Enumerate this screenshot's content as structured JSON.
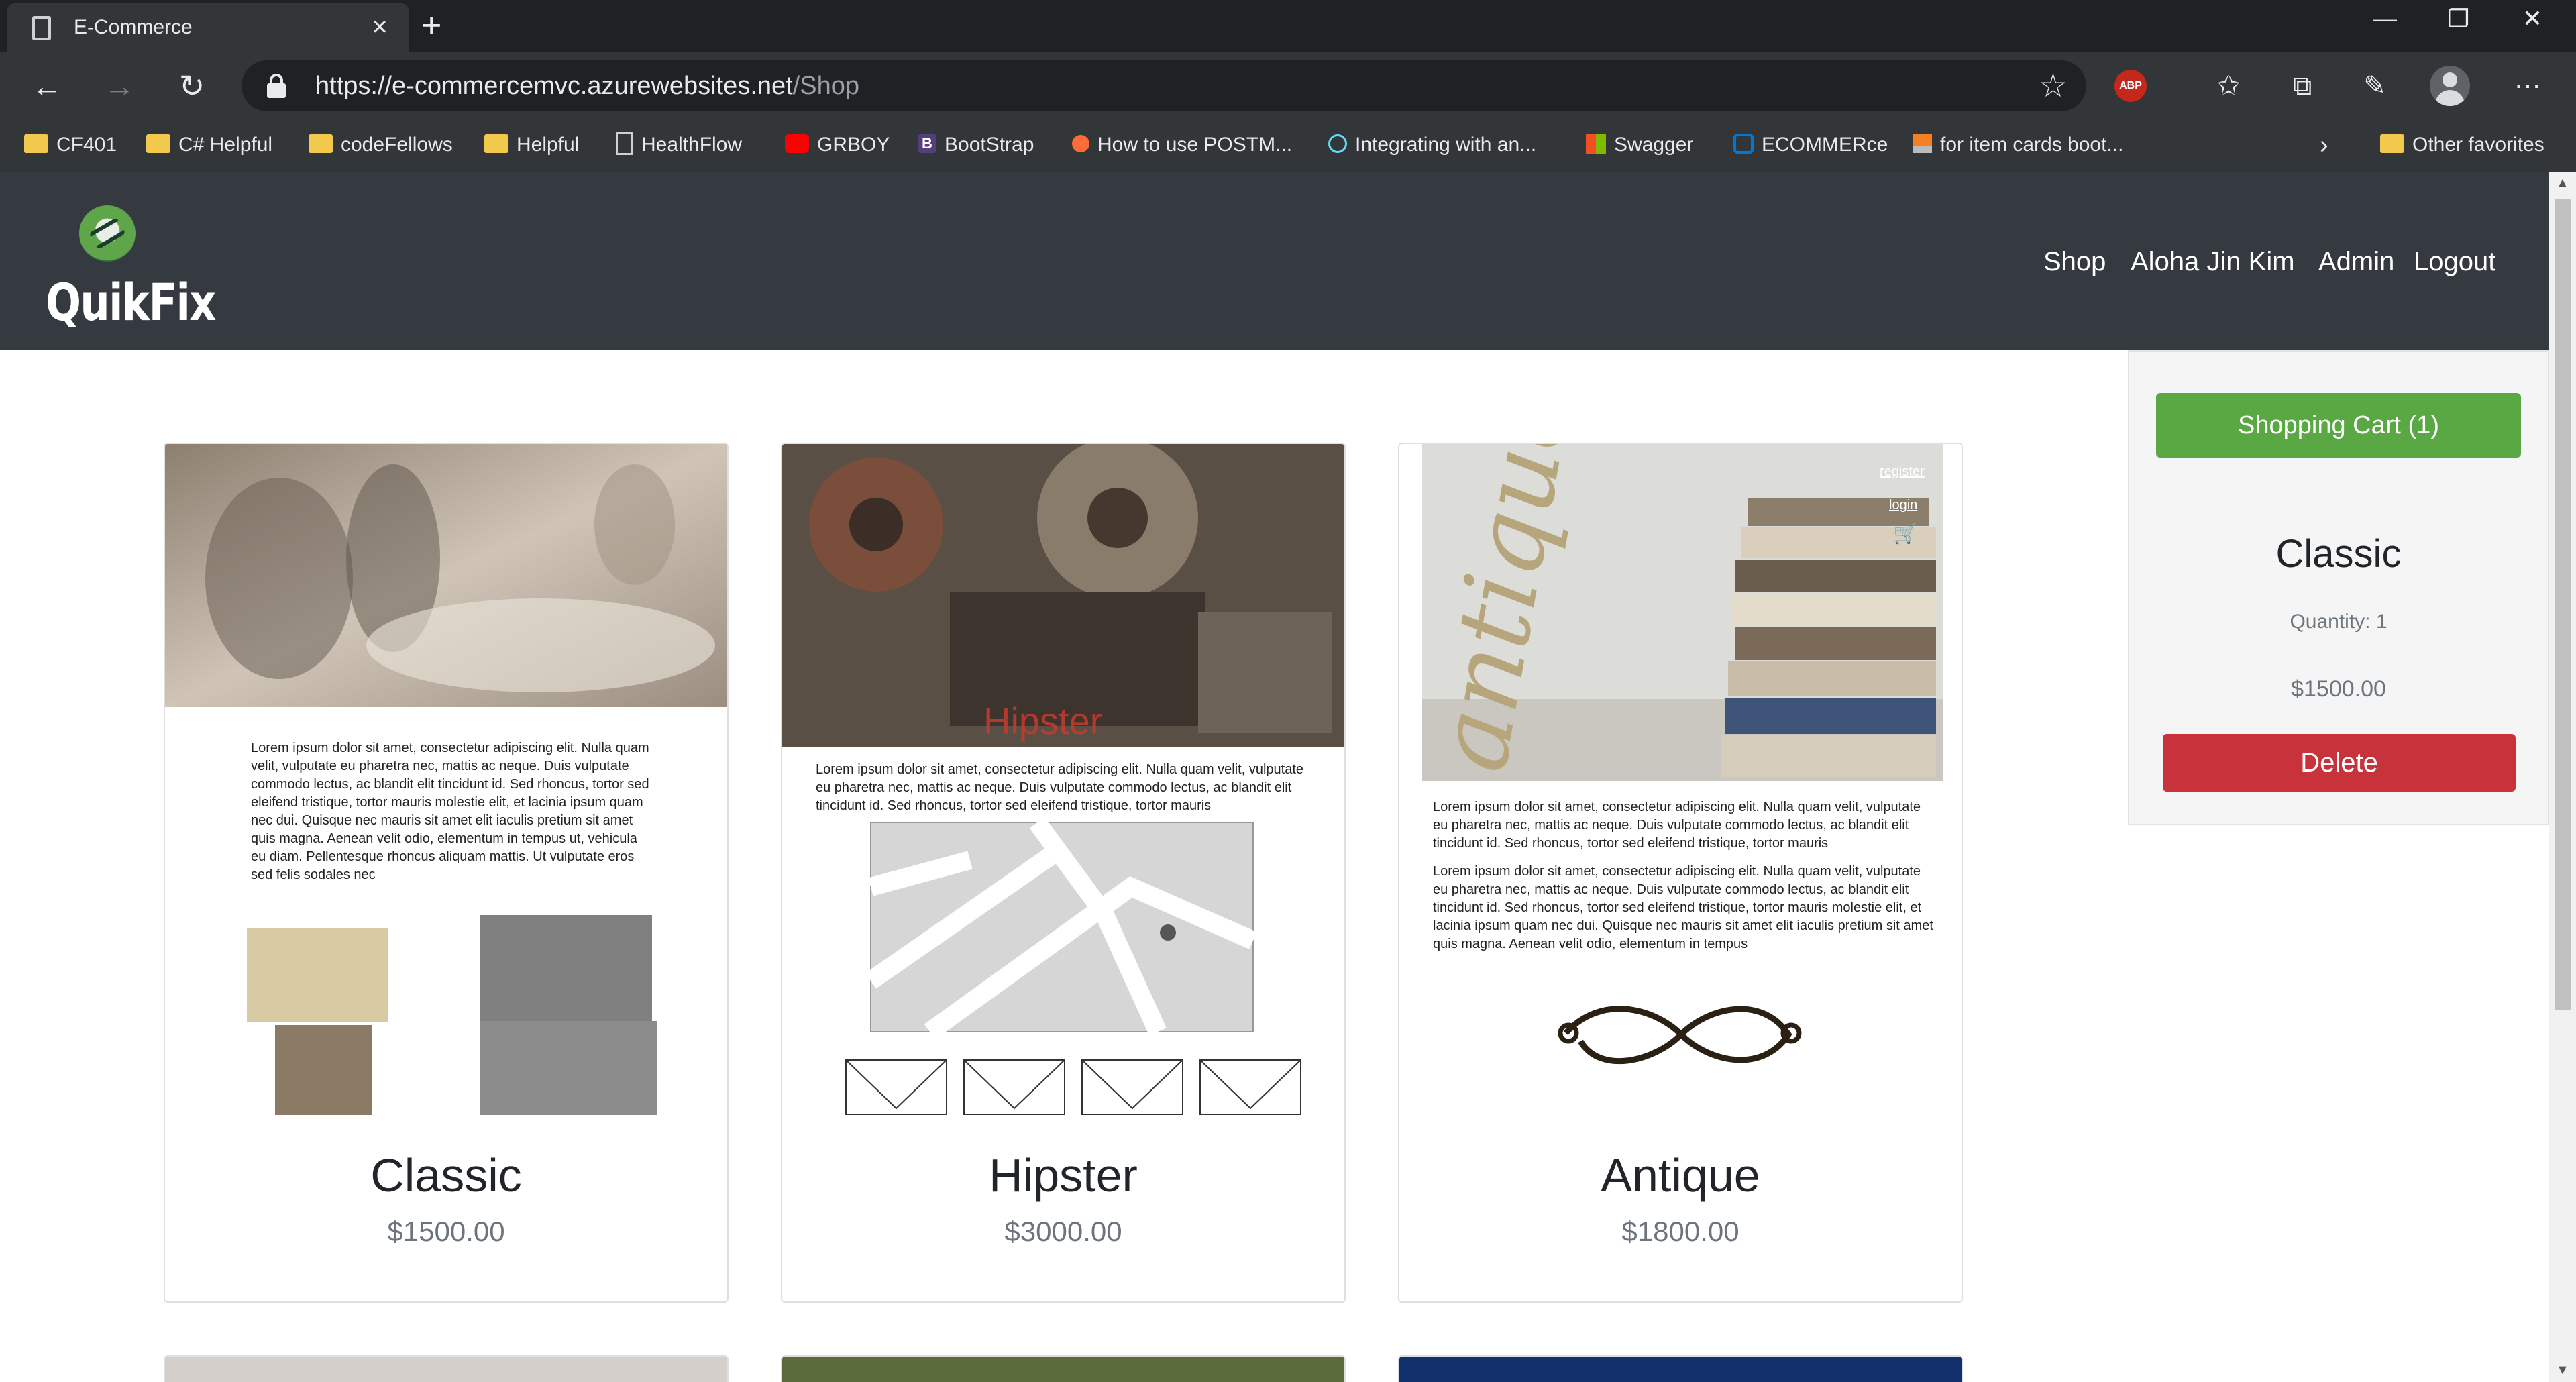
{
  "browser": {
    "tab_title": "E-Commerce",
    "new_tab": "+",
    "url_host": "https://e-commercemvc.azurewebsites.net",
    "url_path": "/Shop",
    "extension_abp": "ABP",
    "bookmarks": [
      {
        "label": "CF401",
        "icon": "folder-icon"
      },
      {
        "label": "C# Helpful",
        "icon": "folder-icon"
      },
      {
        "label": "codeFellows",
        "icon": "folder-icon"
      },
      {
        "label": "Helpful",
        "icon": "folder-icon"
      },
      {
        "label": "HealthFlow",
        "icon": "page-icon"
      },
      {
        "label": "GRBOY",
        "icon": "youtube-icon"
      },
      {
        "label": "BootStrap",
        "icon": "bootstrap-icon"
      },
      {
        "label": "How to use POSTM...",
        "icon": "postman-icon"
      },
      {
        "label": "Integrating with an...",
        "icon": "react-icon"
      },
      {
        "label": "Swagger",
        "icon": "microsoft-icon"
      },
      {
        "label": "ECOMMERce",
        "icon": "azure-devops-icon"
      },
      {
        "label": "for item cards boot...",
        "icon": "stackoverflow-icon"
      }
    ],
    "other_favorites": "Other favorites"
  },
  "site": {
    "logo_text": "QuikFix",
    "nav": {
      "shop": "Shop",
      "user": "Aloha Jin Kim",
      "admin": "Admin",
      "logout": "Logout"
    },
    "products": [
      {
        "name": "Classic",
        "price": "$1500.00",
        "preview_text": "Lorem ipsum dolor sit amet, consectetur adipiscing elit. Nulla quam velit, vulputate eu pharetra nec, mattis ac neque. Duis vulputate commodo lectus, ac blandit elit tincidunt id. Sed rhoncus, tortor sed eleifend tristique, tortor mauris molestie elit, et lacinia ipsum quam nec dui. Quisque nec mauris sit amet elit iaculis pretium sit amet quis magna. Aenean velit odio, elementum in tempus ut, vehicula eu diam. Pellentesque rhoncus aliquam mattis. Ut vulputate eros sed felis sodales nec"
      },
      {
        "name": "Hipster",
        "price": "$3000.00",
        "hero_label": "Hipster",
        "preview_text": "Lorem ipsum dolor sit amet, consectetur adipiscing elit. Nulla quam velit, vulputate eu pharetra nec, mattis ac neque. Duis vulputate commodo lectus, ac blandit elit tincidunt id. Sed rhoncus, tortor sed eleifend tristique, tortor mauris"
      },
      {
        "name": "Antique",
        "price": "$1800.00",
        "hero_label": "antique",
        "link_register": "register",
        "link_login": "login",
        "preview_text_1": "Lorem ipsum dolor sit amet, consectetur adipiscing elit. Nulla quam velit, vulputate eu pharetra nec, mattis ac neque. Duis vulputate commodo lectus, ac blandit elit tincidunt id. Sed rhoncus, tortor sed eleifend tristique, tortor mauris",
        "preview_text_2": "Lorem ipsum dolor sit amet, consectetur adipiscing elit. Nulla quam velit, vulputate eu pharetra nec, mattis ac neque. Duis vulputate commodo lectus, ac blandit elit tincidunt id. Sed rhoncus, tortor sed eleifend tristique, tortor mauris molestie elit, et lacinia ipsum quam nec dui. Quisque nec mauris sit amet elit iaculis pretium sit amet quis magna. Aenean velit odio, elementum in tempus"
      }
    ],
    "cart": {
      "button_label": "Shopping Cart (1)",
      "item_name": "Classic",
      "quantity": "Quantity: 1",
      "price": "$1500.00",
      "delete_label": "Delete"
    },
    "colors": {
      "header_bg": "#343a40",
      "cart_button": "#5aa843",
      "delete_button": "#c8323a"
    }
  }
}
